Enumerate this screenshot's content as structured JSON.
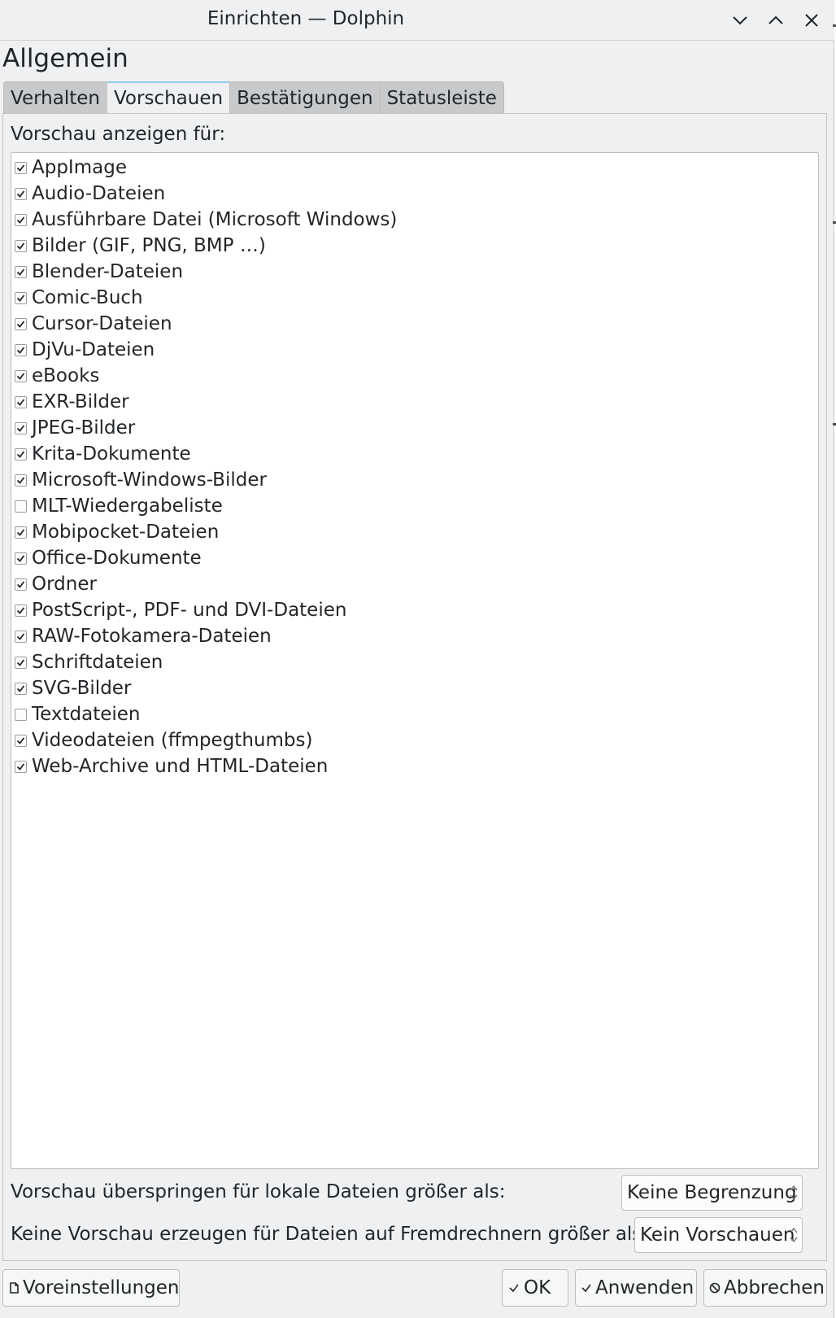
{
  "window": {
    "title": "Einrichten — Dolphin",
    "controls": [
      "minimize-icon",
      "maximize-icon",
      "close-icon"
    ]
  },
  "page": {
    "heading": "Allgemein"
  },
  "tabs": [
    {
      "label": "Verhalten",
      "active": false
    },
    {
      "label": "Vorschauen",
      "active": true
    },
    {
      "label": "Bestätigungen",
      "active": false
    },
    {
      "label": "Statusleiste",
      "active": false
    }
  ],
  "preview": {
    "label": "Vorschau anzeigen für:",
    "items": [
      {
        "label": "AppImage",
        "checked": true
      },
      {
        "label": "Audio-Dateien",
        "checked": true
      },
      {
        "label": "Ausführbare Datei (Microsoft Windows)",
        "checked": true
      },
      {
        "label": "Bilder (GIF, PNG, BMP …)",
        "checked": true
      },
      {
        "label": "Blender-Dateien",
        "checked": true
      },
      {
        "label": "Comic-Buch",
        "checked": true
      },
      {
        "label": "Cursor-Dateien",
        "checked": true
      },
      {
        "label": "DjVu-Dateien",
        "checked": true
      },
      {
        "label": "eBooks",
        "checked": true
      },
      {
        "label": "EXR-Bilder",
        "checked": true
      },
      {
        "label": "JPEG-Bilder",
        "checked": true
      },
      {
        "label": "Krita-Dokumente",
        "checked": true
      },
      {
        "label": "Microsoft-Windows-Bilder",
        "checked": true
      },
      {
        "label": "MLT-Wiedergabeliste",
        "checked": false
      },
      {
        "label": "Mobipocket-Dateien",
        "checked": true
      },
      {
        "label": "Office-Dokumente",
        "checked": true
      },
      {
        "label": "Ordner",
        "checked": true
      },
      {
        "label": "PostScript-, PDF- und DVI-Dateien",
        "checked": true
      },
      {
        "label": "RAW-Fotokamera-Dateien",
        "checked": true
      },
      {
        "label": "Schriftdateien",
        "checked": true
      },
      {
        "label": "SVG-Bilder",
        "checked": true
      },
      {
        "label": "Textdateien",
        "checked": false
      },
      {
        "label": "Videodateien (ffmpegthumbs)",
        "checked": true
      },
      {
        "label": "Web-Archive und HTML-Dateien",
        "checked": true
      }
    ]
  },
  "settings": {
    "local_label": "Vorschau überspringen für lokale Dateien größer als:",
    "local_value": "Keine Begrenzung",
    "remote_label": "Keine Vorschau erzeugen für Dateien auf Fremdrechnern größer als:",
    "remote_value": "Kein Vorschauen"
  },
  "buttons": {
    "defaults": "Voreinstellungen",
    "ok": "OK",
    "apply": "Anwenden",
    "cancel": "Abbrechen"
  },
  "colors": {
    "window_bg": "#eff0f1",
    "list_bg": "#ffffff",
    "accent": "#3daee9",
    "text": "#232629"
  }
}
